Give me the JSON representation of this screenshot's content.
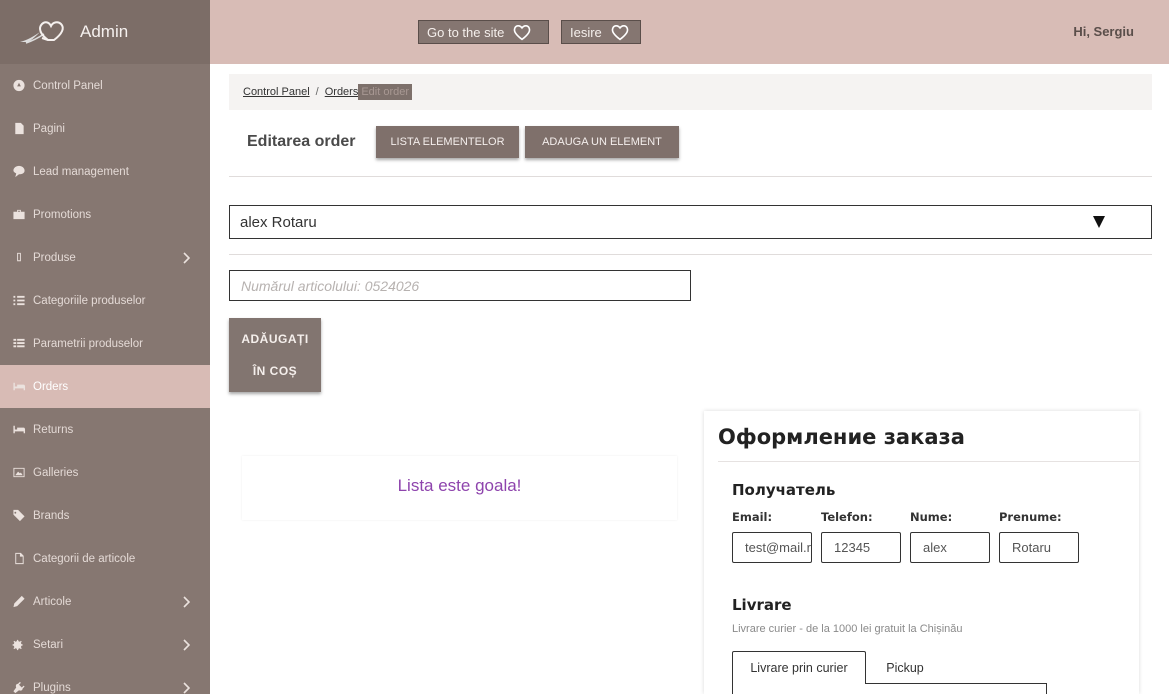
{
  "app": {
    "logo_text": "Admin"
  },
  "header": {
    "site_button": "Go to the site",
    "exit_button": "Iesire",
    "greeting": "Hi, Sergiu"
  },
  "sidebar": {
    "items": [
      {
        "label": "Control Panel",
        "icon": "dashboard-icon",
        "has_submenu": false,
        "active": false
      },
      {
        "label": "Pagini",
        "icon": "file-icon",
        "has_submenu": false,
        "active": false
      },
      {
        "label": "Lead management",
        "icon": "comment-icon",
        "has_submenu": false,
        "active": false
      },
      {
        "label": "Promotions",
        "icon": "briefcase-icon",
        "has_submenu": false,
        "active": false
      },
      {
        "label": "Produse",
        "icon": "mobile-icon",
        "has_submenu": true,
        "active": false
      },
      {
        "label": "Categoriile produselor",
        "icon": "list-icon",
        "has_submenu": false,
        "active": false
      },
      {
        "label": "Parametrii produselor",
        "icon": "table-list-icon",
        "has_submenu": false,
        "active": false
      },
      {
        "label": "Orders",
        "icon": "bed-icon",
        "has_submenu": false,
        "active": true
      },
      {
        "label": "Returns",
        "icon": "bed-icon",
        "has_submenu": false,
        "active": false
      },
      {
        "label": "Galleries",
        "icon": "image-icon",
        "has_submenu": false,
        "active": false
      },
      {
        "label": "Brands",
        "icon": "tag-icon",
        "has_submenu": false,
        "active": false
      },
      {
        "label": "Categorii de articole",
        "icon": "file-outline-icon",
        "has_submenu": false,
        "active": false
      },
      {
        "label": "Articole",
        "icon": "pencil-icon",
        "has_submenu": true,
        "active": false
      },
      {
        "label": "Setari",
        "icon": "cogs-icon",
        "has_submenu": true,
        "active": false
      },
      {
        "label": "Plugins",
        "icon": "plug-icon",
        "has_submenu": true,
        "active": false
      }
    ]
  },
  "breadcrumb": {
    "items": [
      "Control Panel",
      "Orders"
    ],
    "current": "Edit order"
  },
  "page": {
    "title": "Editarea order",
    "list_button": "LISTA ELEMENTELOR",
    "add_button": "ADAUGA UN ELEMENT"
  },
  "client_select": {
    "value": "alex Rotaru"
  },
  "article_input": {
    "value": "",
    "placeholder": "Numărul articolului: 0524026"
  },
  "cart_button": {
    "line1": "ADĂUGAȚI",
    "line2": "ÎN COȘ"
  },
  "empty_list": {
    "message": "Lista este goala!"
  },
  "checkout": {
    "title": "Оформление заказа",
    "recipient_title": "Получатель",
    "fields": [
      {
        "label": "Email:",
        "value": "test@mail.ru"
      },
      {
        "label": "Telefon:",
        "value": "12345"
      },
      {
        "label": "Nume:",
        "value": "alex"
      },
      {
        "label": "Prenume:",
        "value": "Rotaru"
      }
    ],
    "delivery_title": "Livrare",
    "delivery_note": "Livrare curier - de la 1000 lei gratuit la Chișinău",
    "tabs": [
      {
        "label": "Livrare prin curier",
        "active": true
      },
      {
        "label": "Pickup",
        "active": false
      }
    ]
  }
}
